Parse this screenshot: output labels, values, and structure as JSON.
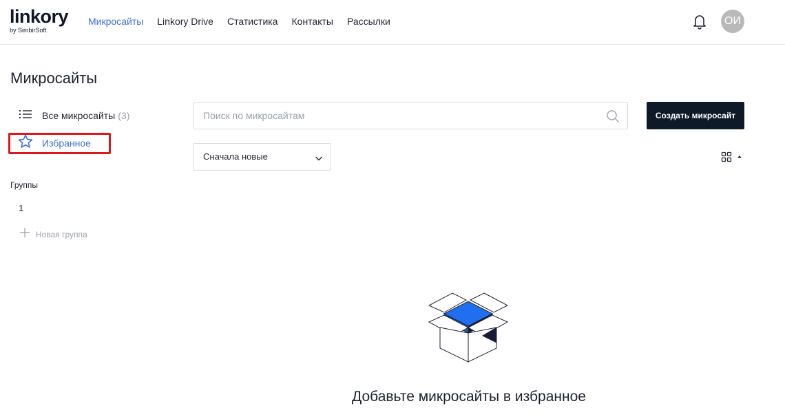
{
  "header": {
    "logo_main": "linkory",
    "logo_sub": "by SimbirSoft",
    "nav": [
      {
        "label": "Микросайты",
        "active": true
      },
      {
        "label": "Linkory Drive",
        "active": false
      },
      {
        "label": "Статистика",
        "active": false
      },
      {
        "label": "Контакты",
        "active": false
      },
      {
        "label": "Рассылки",
        "active": false
      }
    ],
    "notifications_icon": "bell-icon",
    "avatar_initials": "ОИ"
  },
  "page": {
    "title": "Микросайты"
  },
  "sidebar": {
    "all": {
      "label": "Все микросайты",
      "count": "(3)",
      "icon": "list-icon"
    },
    "favorites": {
      "label": "Избранное",
      "icon": "star-icon",
      "highlighted": true
    },
    "groups_title": "Группы",
    "groups": [
      "1"
    ],
    "new_group_label": "Новая группа"
  },
  "toolbar": {
    "search_placeholder": "Поиск по микросайтам",
    "search_value": "",
    "create_label": "Создать микросайт",
    "sort_label": "Сначала новые",
    "view_icon": "grid-view-icon"
  },
  "empty_state": {
    "message": "Добавьте микросайты в избранное",
    "illustration": "open-box-icon"
  },
  "colors": {
    "accent": "#3b6fd6",
    "primary_button": "#0f1a29",
    "highlight_border": "#e0161b",
    "box_blue": "#1f6ff0"
  }
}
